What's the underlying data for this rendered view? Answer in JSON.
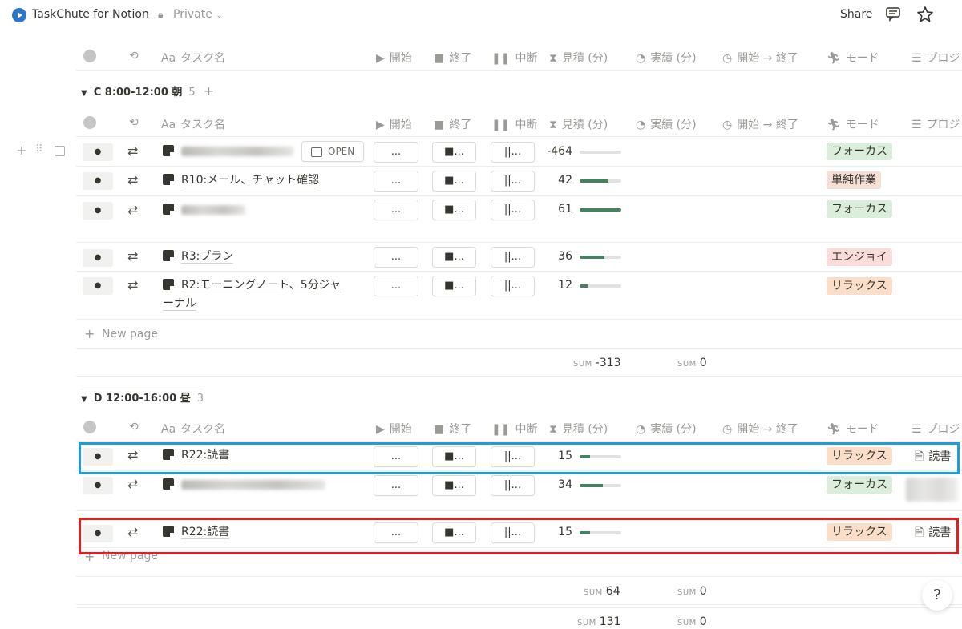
{
  "topbar": {
    "app_title": "TaskChute for Notion",
    "privacy": "Private",
    "share_label": "Share",
    "icons": [
      "play-logo-icon",
      "lock-icon",
      "chevron-down-icon",
      "comment-icon",
      "star-icon"
    ]
  },
  "columns": {
    "status": "",
    "repeat": "",
    "name_prefix": "Aa",
    "name": "タスク名",
    "start": "開始",
    "end": "終了",
    "pause": "中断",
    "estimate": "見積 (分)",
    "actual": "実績 (分)",
    "range": "開始 → 終了",
    "mode": "モード",
    "project": "プロジ"
  },
  "buttons": {
    "start": "...",
    "end": "■...",
    "pause": "||...",
    "open": "OPEN",
    "bullet": "●",
    "swap": "⇄"
  },
  "groups": [
    {
      "label": "C 8:00-12:00 朝",
      "count": "5",
      "rows": [
        {
          "name": "",
          "blurred": true,
          "estimate": "-464",
          "fill": 0,
          "mode": "フォーカス",
          "mode_color": "#dbeddb"
        },
        {
          "name": "R10:メール、チャット確認",
          "estimate": "42",
          "fill": 0.7,
          "mode": "単純作業",
          "mode_color": "#f4dfd6"
        },
        {
          "name": "",
          "blurred": true,
          "estimate": "61",
          "fill": 1,
          "mode": "フォーカス",
          "mode_color": "#dbeddb"
        },
        {
          "name": "R3:プラン",
          "estimate": "36",
          "fill": 0.6,
          "mode": "エンジョイ",
          "mode_color": "#fadcdb"
        },
        {
          "name_line1": "R2:モーニングノート、5分ジャ",
          "name_line2": "ーナル",
          "estimate": "12",
          "fill": 0.2,
          "mode": "リラックス",
          "mode_color": "#fadec9"
        }
      ],
      "new_page": "New page",
      "sum_label": "SUM",
      "sum_estimate": "-313",
      "sum_actual": "0"
    },
    {
      "label": "D 12:00-16:00 昼",
      "count": "3",
      "rows": [
        {
          "name": "R22:読書",
          "estimate": "15",
          "fill": 0.25,
          "mode": "リラックス",
          "mode_color": "#fadec9",
          "project": "読書"
        },
        {
          "name": "",
          "blurred": true,
          "estimate": "34",
          "fill": 0.55,
          "mode": "フォーカス",
          "mode_color": "#dbeddb"
        },
        {
          "name": "R22:読書",
          "estimate": "15",
          "fill": 0.25,
          "mode": "リラックス",
          "mode_color": "#fadec9",
          "project": "読書"
        }
      ],
      "new_page": "New page",
      "sum_label": "SUM",
      "sum_estimate": "64",
      "sum_actual": "0"
    }
  ],
  "total": {
    "sum_label": "SUM",
    "sum_estimate": "131",
    "sum_actual": "0"
  },
  "highlights": {
    "blue": "#1a9fd9",
    "red": "#e02020"
  },
  "help_glyph": "?"
}
